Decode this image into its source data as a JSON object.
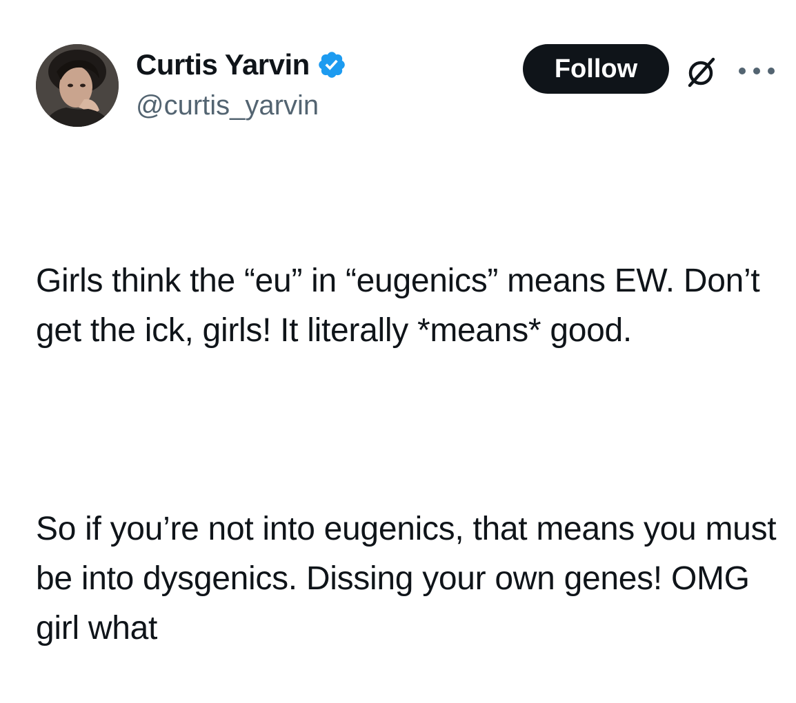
{
  "author": {
    "display_name": "Curtis Yarvin",
    "handle": "@curtis_yarvin",
    "verified": true,
    "avatar_icon": "profile-photo"
  },
  "actions": {
    "follow_label": "Follow",
    "grok_icon": "grok-icon",
    "more_icon": "more-options-icon"
  },
  "colors": {
    "follow_bg": "#0f1419",
    "verified_blue": "#1d9bf0",
    "handle_gray": "#536471",
    "text": "#0f1419"
  },
  "tweet": {
    "paragraphs": [
      "Girls think the “eu” in “eugenics” means EW. Don’t get the ick, girls! It literally *means* good.",
      "So if you’re not into eugenics, that means you must be into dysgenics. Dissing your own genes! OMG girl what"
    ]
  }
}
